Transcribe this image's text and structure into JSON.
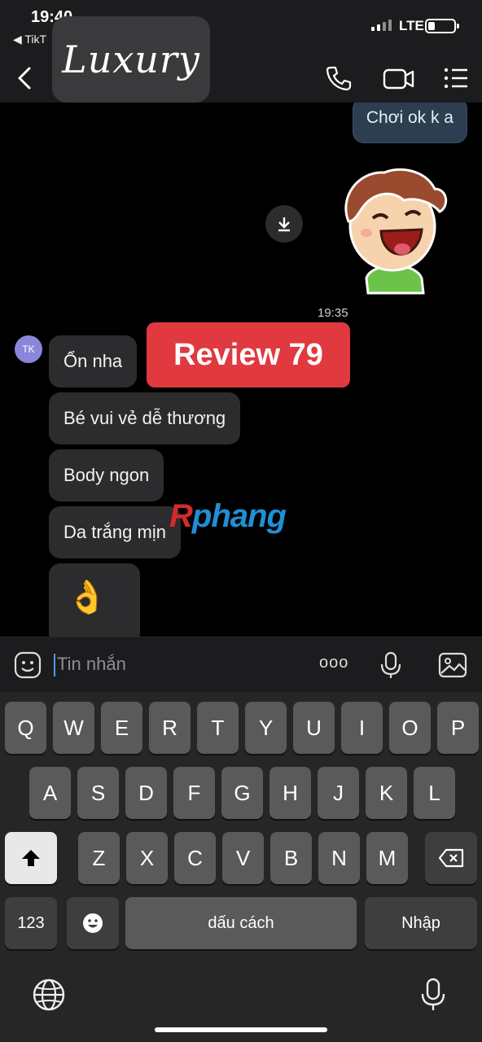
{
  "status_bar": {
    "time": "19:40",
    "back_app": "◀ TikT",
    "network": "LTE"
  },
  "header": {
    "logo_text": "Luxury"
  },
  "icons": {
    "back": "chevron-left-icon",
    "call": "phone-icon",
    "video": "video-camera-icon",
    "menu": "list-menu-icon",
    "download": "download-icon",
    "sticker": "laughing-cartoon-sticker",
    "sticker_emoji": "emoji-sticker-icon",
    "more": "more-dots-icon",
    "mic": "microphone-icon",
    "gallery": "image-gallery-icon",
    "shift": "shift-arrow-icon",
    "backspace": "backspace-icon",
    "emoji": "emoji-smile-icon",
    "globe": "globe-icon",
    "dictation": "dictation-mic-icon"
  },
  "chat": {
    "outgoing": [
      {
        "text": "Chơi ok k a"
      }
    ],
    "timestamp": "19:35",
    "avatar_initials": "TK",
    "incoming": [
      {
        "text": "Ổn nha"
      },
      {
        "text": "Bé vui vẻ dễ thương"
      },
      {
        "text": "Body ngon"
      },
      {
        "text": "Da trắng mịn"
      },
      {
        "text": "👌"
      }
    ],
    "overlay_badge": "Review 79",
    "watermark_r": "R",
    "watermark_rest": "phang"
  },
  "input": {
    "placeholder": "Tin nhắn",
    "more_dots": "ooo"
  },
  "keyboard": {
    "row1": [
      "Q",
      "W",
      "E",
      "R",
      "T",
      "Y",
      "U",
      "I",
      "O",
      "P"
    ],
    "row2": [
      "A",
      "S",
      "D",
      "F",
      "G",
      "H",
      "J",
      "K",
      "L"
    ],
    "row3": [
      "Z",
      "X",
      "C",
      "V",
      "B",
      "N",
      "M"
    ],
    "numbers_key": "123",
    "space_key": "dấu cách",
    "return_key": "Nhập"
  },
  "colors": {
    "accent_badge": "#e0393f",
    "outgoing_bubble": "#2c3e50",
    "incoming_bubble": "#2c2c2e",
    "avatar": "#8a86d9"
  }
}
